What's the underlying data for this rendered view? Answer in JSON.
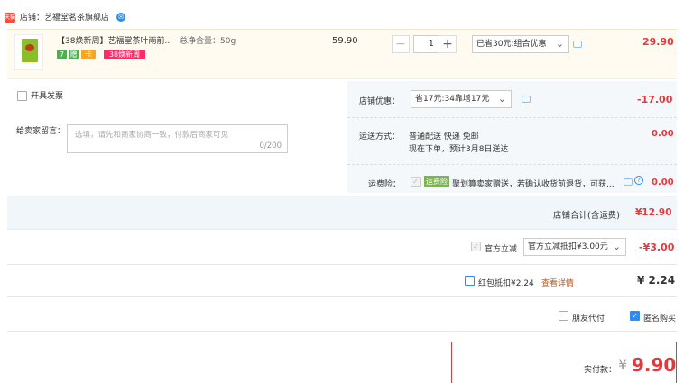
{
  "store": {
    "badge": "天猫",
    "label": "店铺：",
    "name": "艺福堂茗茶旗舰店",
    "chat_icon": "chat-icon"
  },
  "product": {
    "title": "【38焕新周】艺福堂茶叶雨前...",
    "spec": "总净含量：50g",
    "price": "59.90",
    "qty": "1",
    "minus": "−",
    "plus": "+",
    "discount": "已省30元:组合优惠",
    "total": "29.90",
    "tags": [
      "7",
      "赠",
      "卡"
    ],
    "promo_tag": "38焕新周"
  },
  "invoice": {
    "label": "开具发票"
  },
  "message": {
    "label": "给卖家留言：",
    "placeholder": "选填，请先和商家协商一致，付款后商家可见",
    "counter": "0/200"
  },
  "store_coupon": {
    "label": "店铺优惠：",
    "select": "省17元:34靠增17元",
    "amount": "-17.00"
  },
  "shipping": {
    "label": "运送方式：",
    "line1": "普通配送 快递 免邮",
    "line2": "现在下单，预计3月8日送达",
    "amount": "0.00"
  },
  "insurance": {
    "label": "运费险：",
    "badge": "运费险",
    "text": "聚划算卖家赠送，若确认收货前退货，可获...",
    "amount": "0.00",
    "help": "?"
  },
  "store_total": {
    "label": "店铺合计(含运费)",
    "amount": "¥12.90"
  },
  "reduction": {
    "label": "官方立减",
    "select": "官方立减抵扣¥3.00元",
    "amount": "-¥3.00"
  },
  "redpacket": {
    "label": "红包抵扣¥2.24",
    "link": "查看详情",
    "amount": "¥ 2.24"
  },
  "options": {
    "friend_pay": "朋友代付",
    "anonymous": "匿名购买"
  },
  "pay": {
    "label": "实付款：",
    "symbol": "¥",
    "amount": "9.90"
  },
  "colors": {
    "accent": "#e4393c",
    "blue": "#2d8cf0",
    "bg_light": "#f5f8fb"
  }
}
